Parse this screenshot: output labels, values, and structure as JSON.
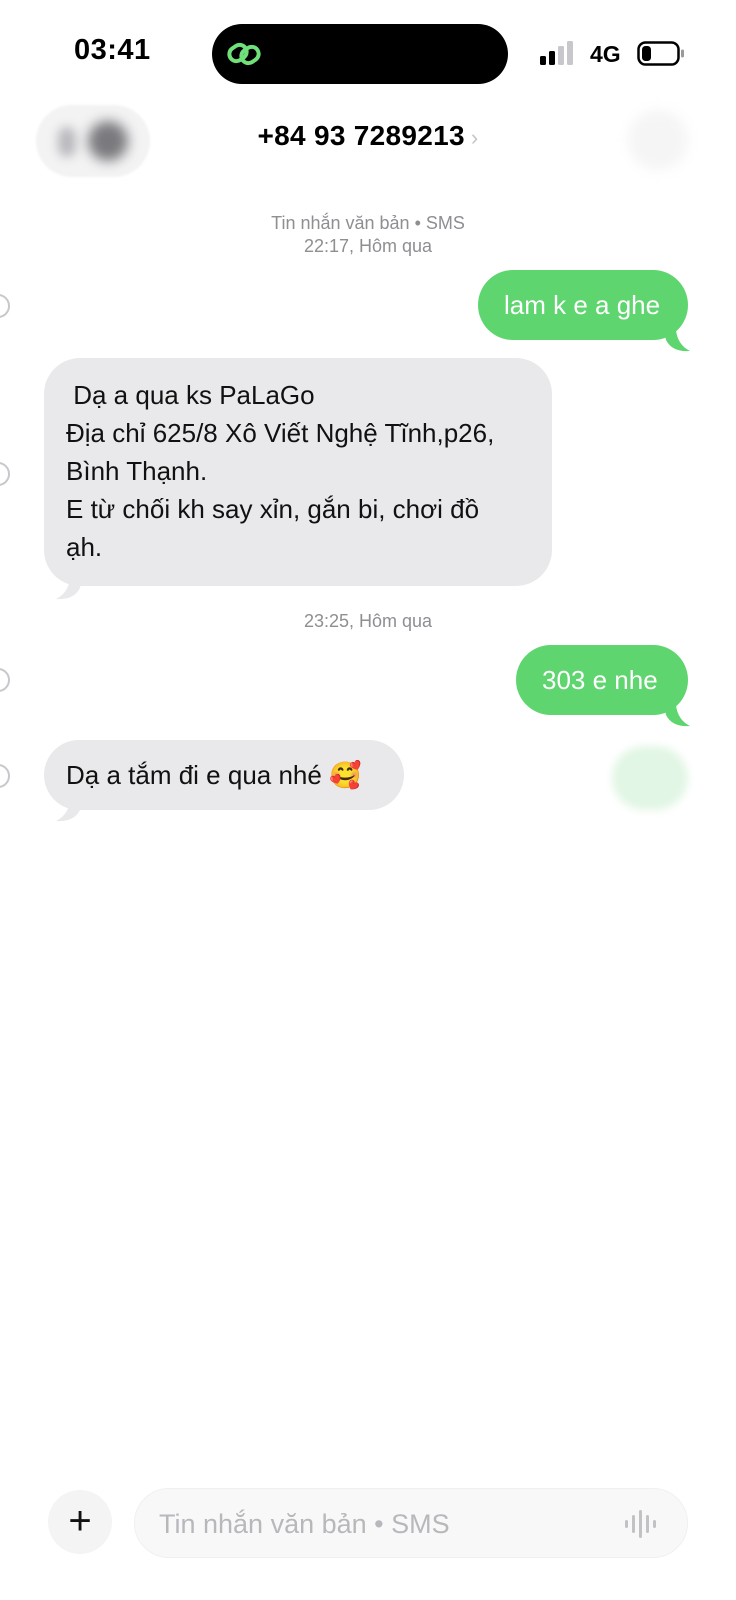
{
  "status_bar": {
    "time": "03:41",
    "network": "4G"
  },
  "header": {
    "contact": "+84 93 7289213",
    "chevron": "›"
  },
  "timestamps": [
    {
      "line1": "Tin nhắn văn bản • SMS",
      "line2": "22:17, Hôm qua"
    },
    {
      "line1": "23:25, Hôm qua"
    }
  ],
  "messages": [
    {
      "direction": "outgoing",
      "text": "lam k e a ghe"
    },
    {
      "direction": "incoming",
      "lines": [
        " Dạ a qua ks PaLaGo",
        "Địa chỉ 625/8 Xô Viết Nghệ Tĩnh,p26,",
        "Bình Thạnh.",
        "E từ chối kh say xỉn, gắn bi, chơi đồ",
        "ạh."
      ]
    },
    {
      "direction": "outgoing",
      "text": "303 e nhe"
    },
    {
      "direction": "incoming",
      "text": "Dạ a tắm đi e qua nhé",
      "emoji": "🥰"
    }
  ],
  "composer": {
    "plus": "+",
    "placeholder": "Tin nhắn văn bản • SMS"
  },
  "colors": {
    "outgoing_bubble": "#5ed56e",
    "incoming_bubble": "#e9e9eb",
    "timestamp": "#8e8e93"
  },
  "icons": {
    "island": "link-icon",
    "signal": "signal-bars-icon",
    "battery": "battery-icon",
    "back": "chevron-left-icon",
    "mic": "waveform-icon"
  }
}
